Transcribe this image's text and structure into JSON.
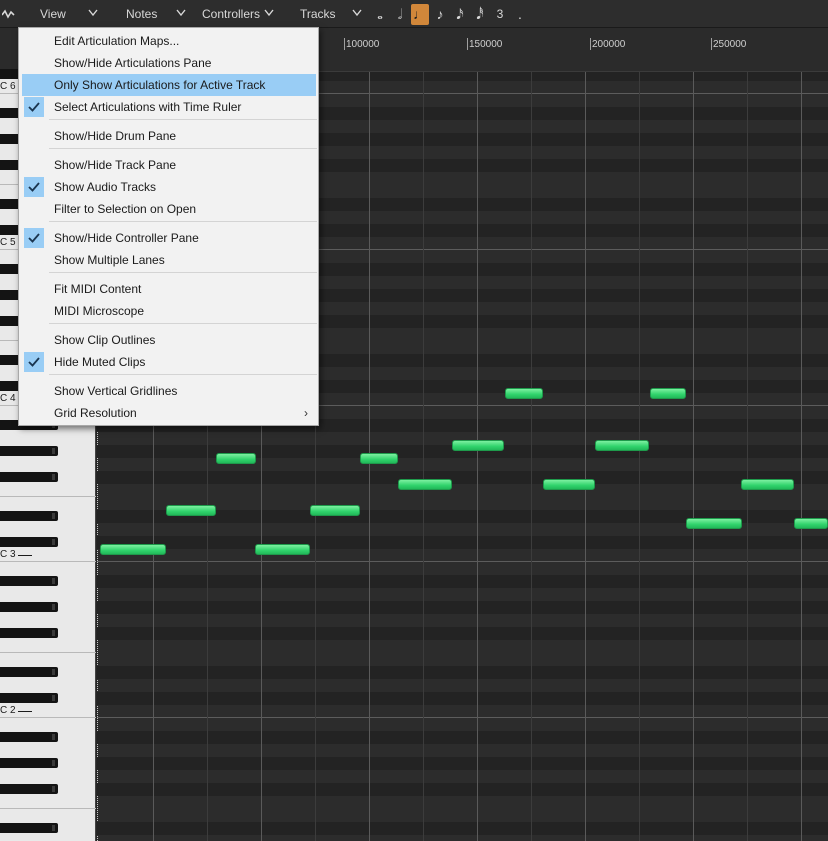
{
  "toolbar": {
    "menus": [
      {
        "label": "View"
      },
      {
        "label": "Notes"
      },
      {
        "label": "Controllers"
      },
      {
        "label": "Tracks"
      }
    ],
    "note_values": [
      "𝅝",
      "𝅗𝅥",
      "♩",
      "♪",
      "𝅘𝅥𝅯",
      "𝅘𝅥𝅰",
      "3",
      "."
    ],
    "active_note_index": 2,
    "accent_color": "#d1873a"
  },
  "ruler": {
    "labels": [
      "100000",
      "150000",
      "200000",
      "250000"
    ]
  },
  "keyboard": {
    "octave_labels": [
      "C 6",
      "C 5",
      "C 4",
      "C 3",
      "C 2"
    ]
  },
  "menu": {
    "items": [
      {
        "label": "Edit Articulation Maps...",
        "checked": false,
        "highlighted": false
      },
      {
        "label": "Show/Hide Articulations Pane",
        "checked": false,
        "highlighted": false
      },
      {
        "label": "Only Show Articulations for Active Track",
        "checked": false,
        "highlighted": true
      },
      {
        "label": "Select Articulations with Time Ruler",
        "checked": true,
        "highlighted": false
      },
      {
        "label": "Show/Hide Drum Pane",
        "checked": false,
        "highlighted": false
      },
      {
        "label": "Show/Hide Track Pane",
        "checked": false,
        "highlighted": false
      },
      {
        "label": "Show Audio Tracks",
        "checked": true,
        "highlighted": false
      },
      {
        "label": "Filter to Selection on Open",
        "checked": false,
        "highlighted": false
      },
      {
        "label": "Show/Hide Controller Pane",
        "checked": true,
        "highlighted": false
      },
      {
        "label": "Show Multiple Lanes",
        "checked": false,
        "highlighted": false
      },
      {
        "label": "Fit MIDI Content",
        "checked": false,
        "highlighted": false
      },
      {
        "label": "MIDI Microscope",
        "checked": false,
        "highlighted": false
      },
      {
        "label": "Show Clip Outlines",
        "checked": false,
        "highlighted": false
      },
      {
        "label": "Hide Muted Clips",
        "checked": true,
        "highlighted": false
      },
      {
        "label": "Show Vertical Gridlines",
        "checked": false,
        "highlighted": false
      },
      {
        "label": "Grid Resolution",
        "checked": false,
        "highlighted": false,
        "submenu": true
      }
    ],
    "highlight_color": "#99cdf5"
  },
  "notes": {
    "color": "#30d36c",
    "count": 19
  }
}
